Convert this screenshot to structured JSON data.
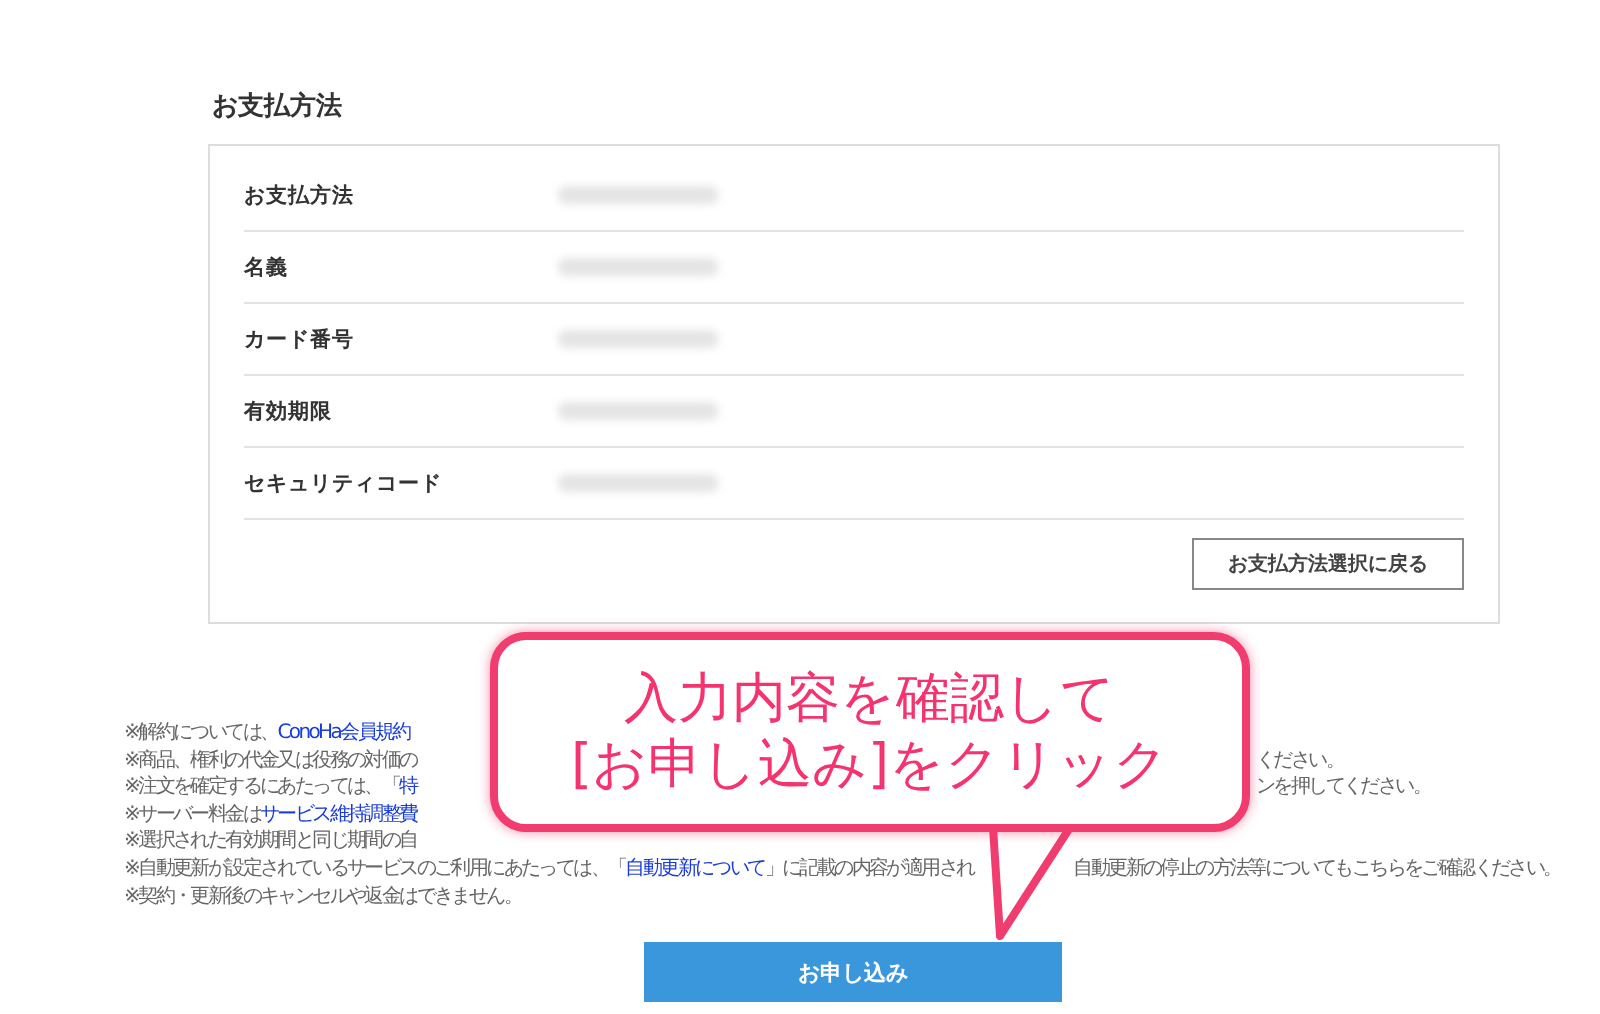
{
  "section_title": "お支払方法",
  "fields": [
    {
      "label": "お支払方法"
    },
    {
      "label": "名義"
    },
    {
      "label": "カード番号"
    },
    {
      "label": "有効期限"
    },
    {
      "label": "セキュリティコード"
    }
  ],
  "back_button": "お支払方法選択に戻る",
  "notes": [
    {
      "kind": "covered",
      "parts": [
        {
          "text": "※解約については、",
          "link": false
        },
        {
          "text": "ConoHa会員規約",
          "link": true
        }
      ]
    },
    {
      "kind": "covered",
      "parts": [
        {
          "text": "※商品、権利の代金又は役務の対価の",
          "link": false
        }
      ],
      "right": "ください。"
    },
    {
      "kind": "covered",
      "parts": [
        {
          "text": "※注文を確定するにあたっては、「",
          "link": false
        },
        {
          "text": "特",
          "link": true
        }
      ],
      "right": "ンを押してください。"
    },
    {
      "kind": "covered",
      "parts": [
        {
          "text": "※サーバー料金は",
          "link": false
        },
        {
          "text": "サービス維持調整費",
          "link": true
        }
      ]
    },
    {
      "kind": "covered",
      "parts": [
        {
          "text": "※選択された有効期間と同じ期間の自",
          "link": false
        }
      ]
    },
    {
      "kind": "tail",
      "parts": [
        {
          "text": "※自動更新が設定されているサービスのご利用にあたっては、「",
          "link": false
        },
        {
          "text": "自動更新について",
          "link": true
        },
        {
          "text": "」に記載の内容が適用され",
          "link": false
        }
      ],
      "right": "自動更新の停止の方法等についてもこちらをご確認ください。"
    },
    {
      "kind": "full",
      "parts": [
        {
          "text": "※契約・更新後のキャンセルや返金はできません。",
          "link": false
        }
      ]
    }
  ],
  "callout": {
    "lines": [
      "入力内容を確認して",
      "[お申し込み]をクリック"
    ]
  },
  "submit_button": "お申し込み"
}
